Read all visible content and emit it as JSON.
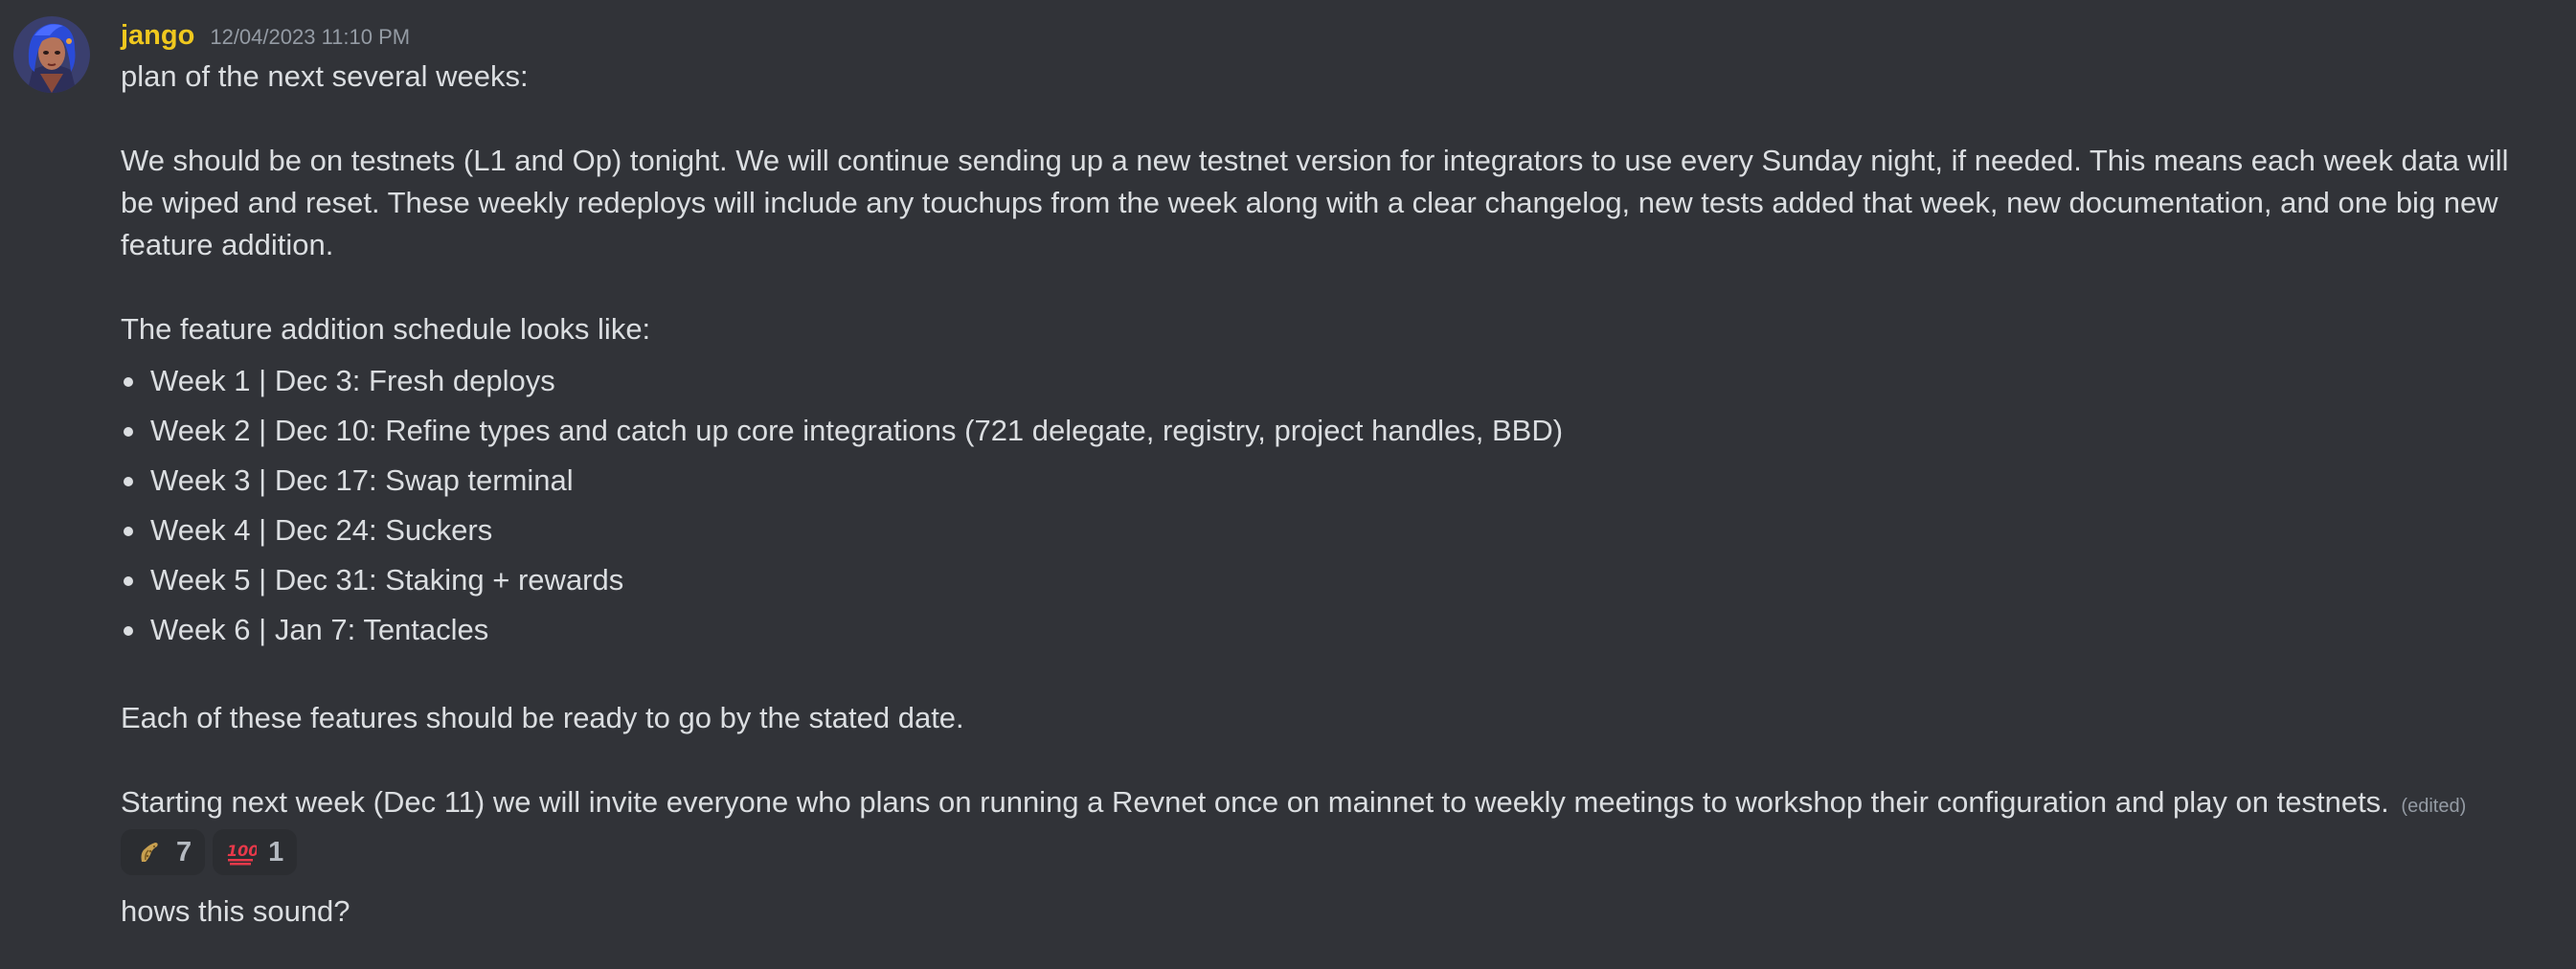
{
  "message": {
    "author": "jango",
    "timestamp": "12/04/2023 11:10 PM",
    "author_color": "#f0c81e",
    "avatar_icon": "user-avatar",
    "intro": "plan of the next several weeks:",
    "paragraph_1": "We should be on testnets (L1 and Op) tonight. We will continue sending up a new testnet version for integrators to use every Sunday night, if needed. This means each week data will be wiped and reset. These weekly redeploys will include any touchups from the week along with a clear changelog, new tests added that week, new documentation, and one big new feature addition.",
    "schedule_heading": "The feature addition schedule looks like:",
    "schedule": [
      "Week 1 | Dec 3: Fresh deploys",
      "Week 2 | Dec 10: Refine types and catch up core integrations (721 delegate, registry, project handles, BBD)",
      "Week 3 | Dec 17: Swap terminal",
      "Week 4 | Dec 24: Suckers",
      "Week 5 | Dec 31: Staking + rewards",
      "Week 6 | Jan 7: Tentacles"
    ],
    "paragraph_2": "Each of these features should be ready to go by the stated date.",
    "paragraph_3": "Starting next week (Dec 11) we will invite everyone who plans on running a Revnet once on mainnet to weekly meetings to workshop their configuration and play on testnets.",
    "edited_label": "(edited)",
    "reactions": [
      {
        "icon": "tentacle-emoji-icon",
        "count": "7"
      },
      {
        "icon": "hundred-points-emoji-icon",
        "count": "1"
      }
    ],
    "followup": "hows this sound?"
  },
  "colors": {
    "background": "#313338",
    "text": "#dbdee1",
    "muted": "#949ba4",
    "reaction_bg": "#2b2d31"
  }
}
